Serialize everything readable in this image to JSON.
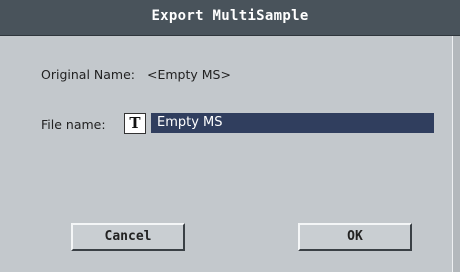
{
  "dialog": {
    "title": "Export MultiSample",
    "original_name": {
      "label": "Original Name:",
      "value": "<Empty MS>"
    },
    "file_name": {
      "label": "File name:",
      "icon": "text-edit-icon",
      "icon_glyph": "T",
      "value": "Empty MS"
    },
    "buttons": {
      "cancel": "Cancel",
      "ok": "OK"
    }
  },
  "colors": {
    "titlebar": "#49535b",
    "background": "#c3c8cc",
    "field_selected": "#303e5e"
  }
}
